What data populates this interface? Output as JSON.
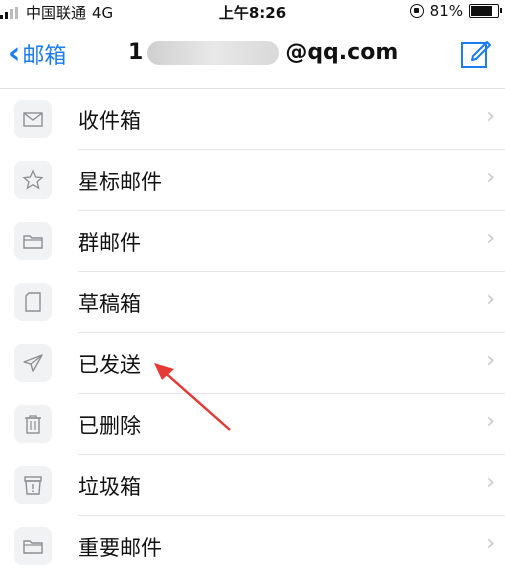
{
  "status_bar": {
    "carrier": "中国联通",
    "network": "4G",
    "time": "上午8:26",
    "battery": "81%",
    "battery_level": 0.81
  },
  "nav": {
    "back_label": "邮箱",
    "account_visible_suffix": "@qq.com",
    "account_partial_prefix": "1"
  },
  "folders": [
    {
      "label": "收件箱",
      "icon": "inbox-icon"
    },
    {
      "label": "星标邮件",
      "icon": "star-icon"
    },
    {
      "label": "群邮件",
      "icon": "folder-icon"
    },
    {
      "label": "草稿箱",
      "icon": "draft-icon"
    },
    {
      "label": "已发送",
      "icon": "sent-icon"
    },
    {
      "label": "已删除",
      "icon": "trash-icon"
    },
    {
      "label": "垃圾箱",
      "icon": "spam-icon"
    },
    {
      "label": "重要邮件",
      "icon": "folder-icon"
    }
  ],
  "colors": {
    "accent": "#1a7cf3",
    "annotation_arrow": "#e53935"
  }
}
